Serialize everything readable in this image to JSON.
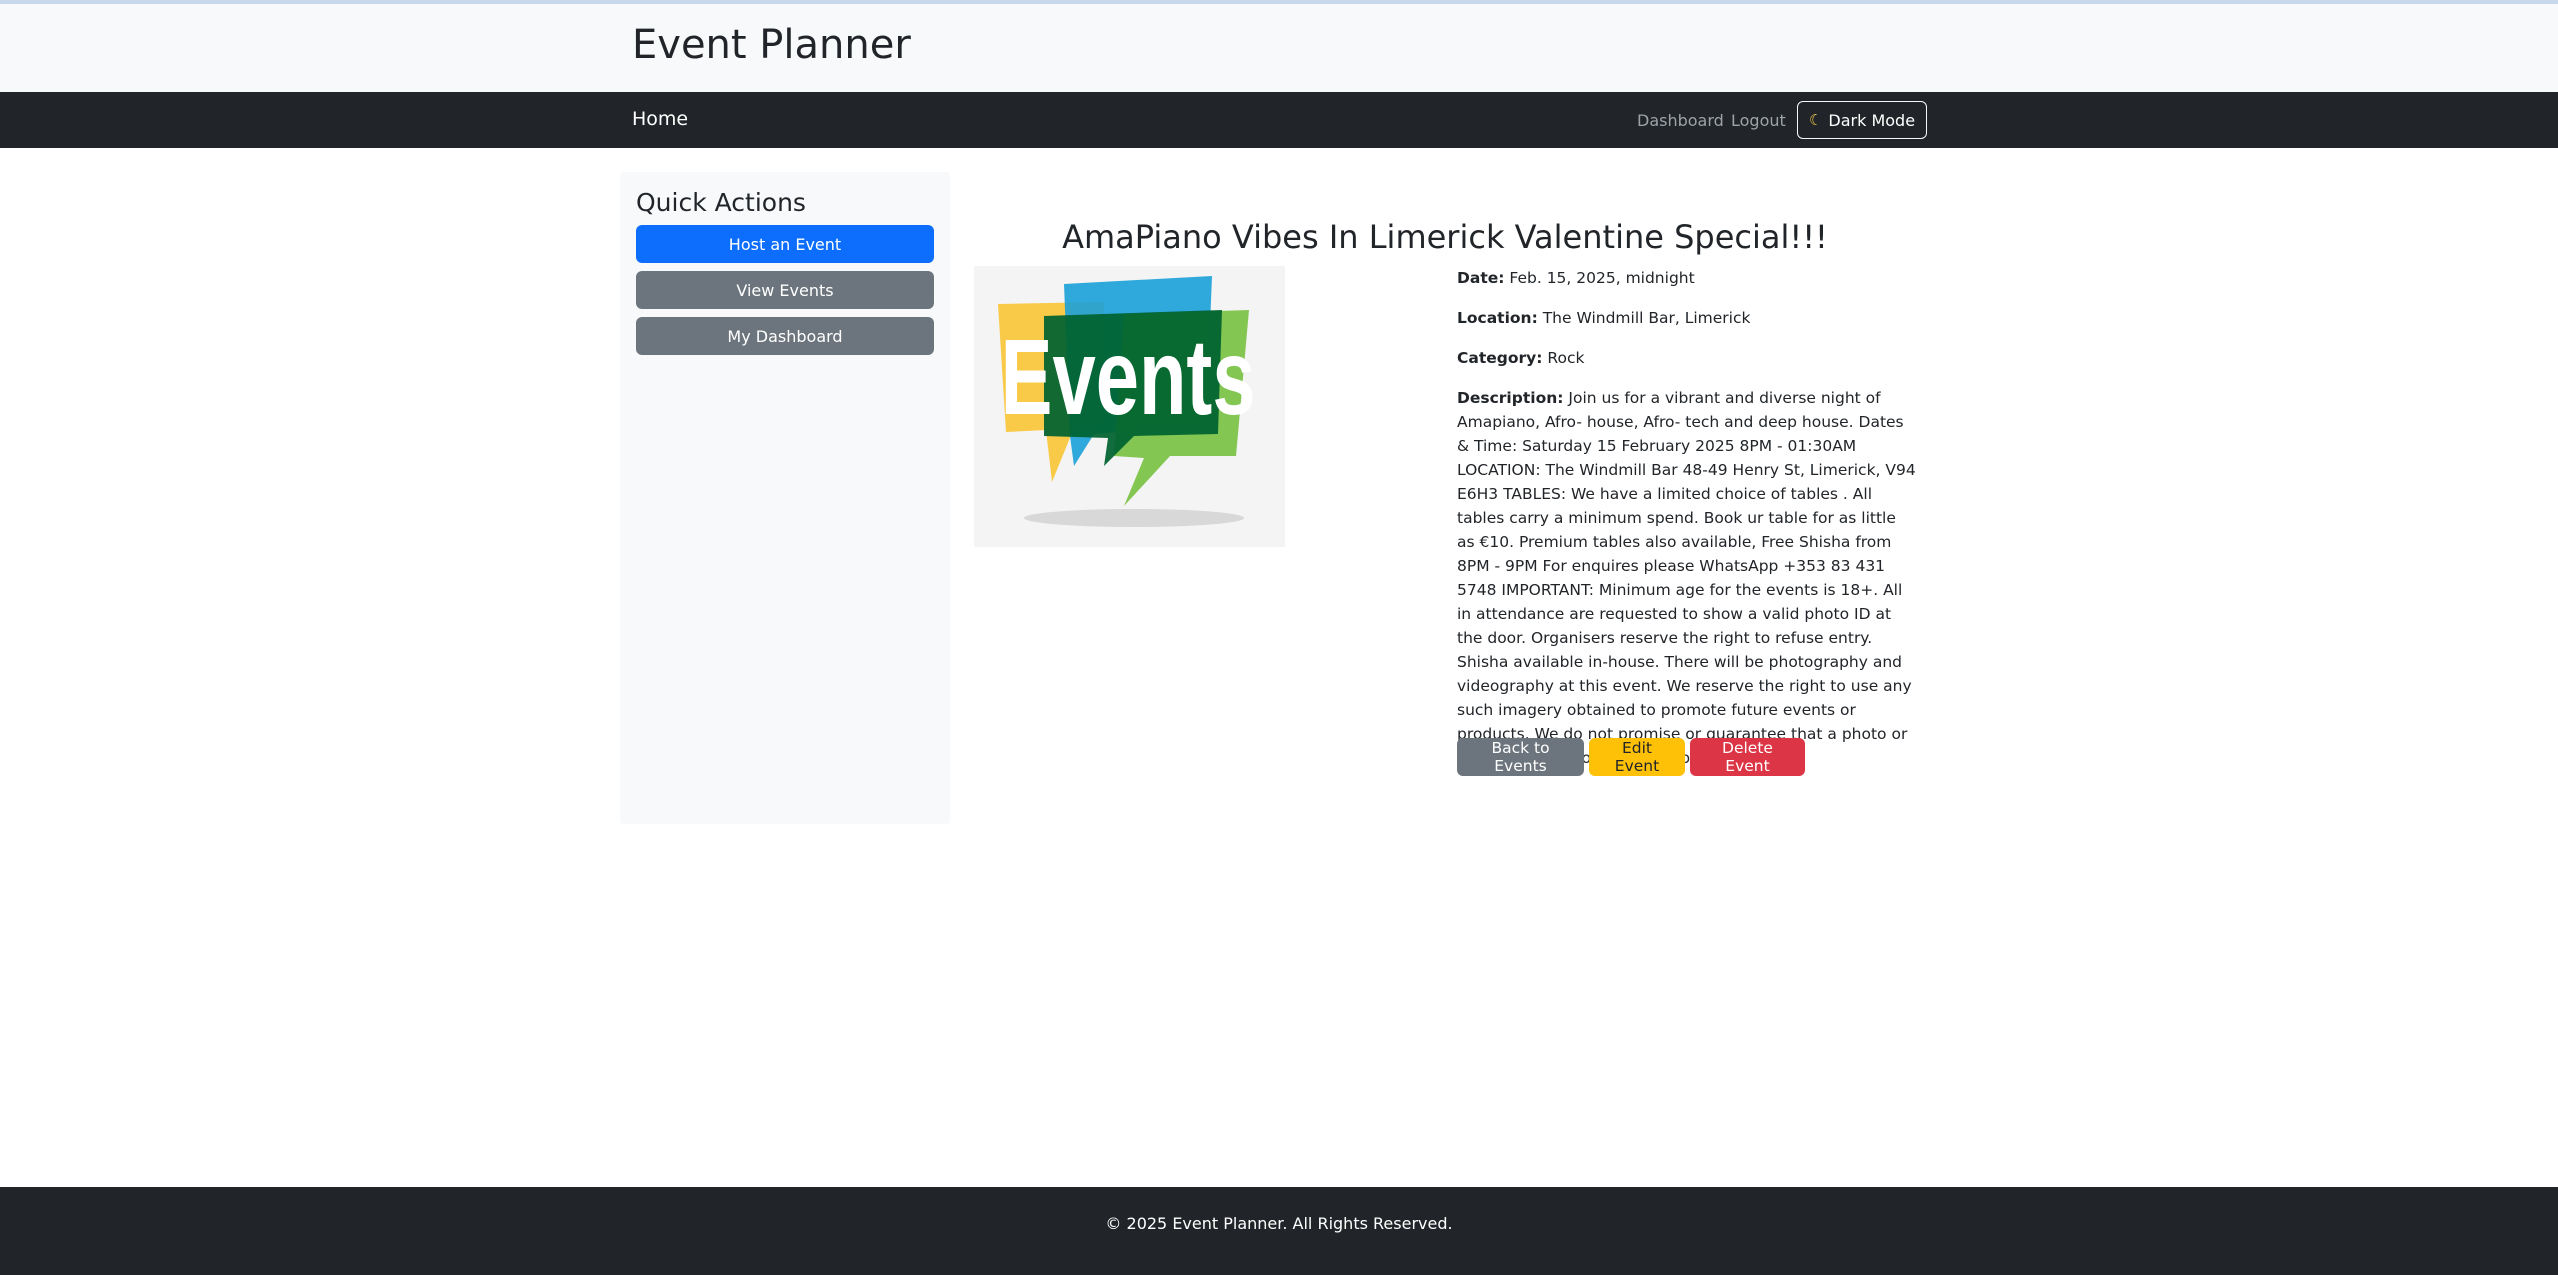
{
  "header": {
    "site_title": "Event Planner"
  },
  "nav": {
    "home": "Home",
    "dashboard": "Dashboard",
    "logout": "Logout",
    "dark_mode": "Dark Mode",
    "dark_mode_icon": "moon-icon"
  },
  "sidebar": {
    "title": "Quick Actions",
    "buttons": [
      {
        "label": "Host an Event"
      },
      {
        "label": "View Events"
      },
      {
        "label": "My Dashboard"
      }
    ]
  },
  "event": {
    "title": "AmaPiano Vibes In Limerick Valentine Special!!!",
    "image_text": "Events",
    "date_label": "Date:",
    "date": "Feb. 15, 2025, midnight",
    "location_label": "Location:",
    "location": "The Windmill Bar, Limerick",
    "category_label": "Category:",
    "category": "Rock",
    "description_label": "Description:",
    "description": "Join us for a vibrant and diverse night of Amapiano, Afro- house, Afro- tech and deep house. Dates & Time: Saturday 15 February 2025 8PM - 01:30AM LOCATION: The Windmill Bar 48-49 Henry St, Limerick, V94 E6H3 TABLES: We have a limited choice of tables . All tables carry a minimum spend. Book ur table for as little as €10. Premium tables also available, Free Shisha from 8PM - 9PM For enquires please WhatsApp +353 83 431 5748 IMPORTANT: Minimum age for the events is 18+. All in attendance are requested to show a valid photo ID at the door. Organisers reserve the right to refuse entry. Shisha available in-house. There will be photography and videography at this event. We reserve the right to use any such imagery obtained to promote future events or products. We do not promise or guarantee that a photo or video taken of you will be published."
  },
  "actions": {
    "back": "Back to Events",
    "edit": "Edit Event",
    "delete": "Delete Event"
  },
  "footer": {
    "text": "© 2025 Event Planner. All Rights Reserved."
  },
  "colors": {
    "primary": "#0d6efd",
    "secondary": "#6c757d",
    "warning": "#ffc107",
    "danger": "#dc3545",
    "dark": "#212529"
  }
}
